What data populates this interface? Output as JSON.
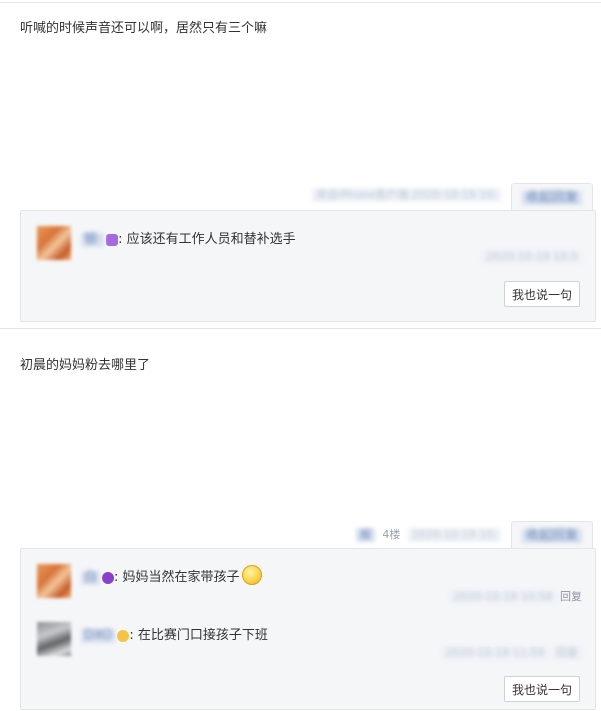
{
  "posts": [
    {
      "text": "听喊的时候声音还可以啊，居然只有三个嘛",
      "meta": "来自iPhone客户端  2020-10-19 10:",
      "reply_tab": "收起回复",
      "replies": [
        {
          "user": "银·",
          "text": "应该还有工作人员和替补选手",
          "meta": "2020-10-19 10:5"
        }
      ],
      "say_button": "我也说一句"
    },
    {
      "text": "初晨的妈妈粉去哪里了",
      "meta_user": "报",
      "meta_floor": "4楼",
      "meta_time": "2020-10-19 10:",
      "reply_tab": "收起回复",
      "replies": [
        {
          "user": "白",
          "text": "妈妈当然在家带孩子",
          "meta_time": "2020-10-19 10:58",
          "meta_reply": "回复"
        },
        {
          "user": "DXO",
          "text": "在比赛门口接孩子下班",
          "meta_time": "2020-10-19 11:59",
          "meta_reply": "回复"
        }
      ],
      "say_button": "我也说一句"
    }
  ]
}
